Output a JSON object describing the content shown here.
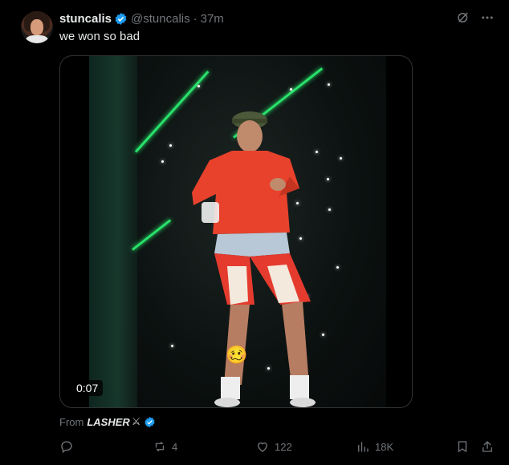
{
  "tweet": {
    "author_name": "stuncalis",
    "handle": "@stuncalis",
    "separator": "·",
    "time": "37m",
    "text": "we won so bad",
    "video_time": "0:07",
    "source_prefix": "From",
    "source_account": "LASHER",
    "emoji_overlay": "🥴"
  },
  "actions": {
    "retweets": "4",
    "likes": "122",
    "views": "18K"
  },
  "icons": {
    "grok": "grok-icon",
    "more": "more-icon",
    "reply": "reply-icon",
    "retweet": "retweet-icon",
    "like": "heart-icon",
    "views": "views-icon",
    "bookmark": "bookmark-icon",
    "share": "share-icon"
  },
  "colors": {
    "background": "#000000",
    "text": "#e7e9ea",
    "muted": "#71767b",
    "verified": "#1d9bf0",
    "laser": "#28e06a",
    "jacket": "#e8422c"
  }
}
